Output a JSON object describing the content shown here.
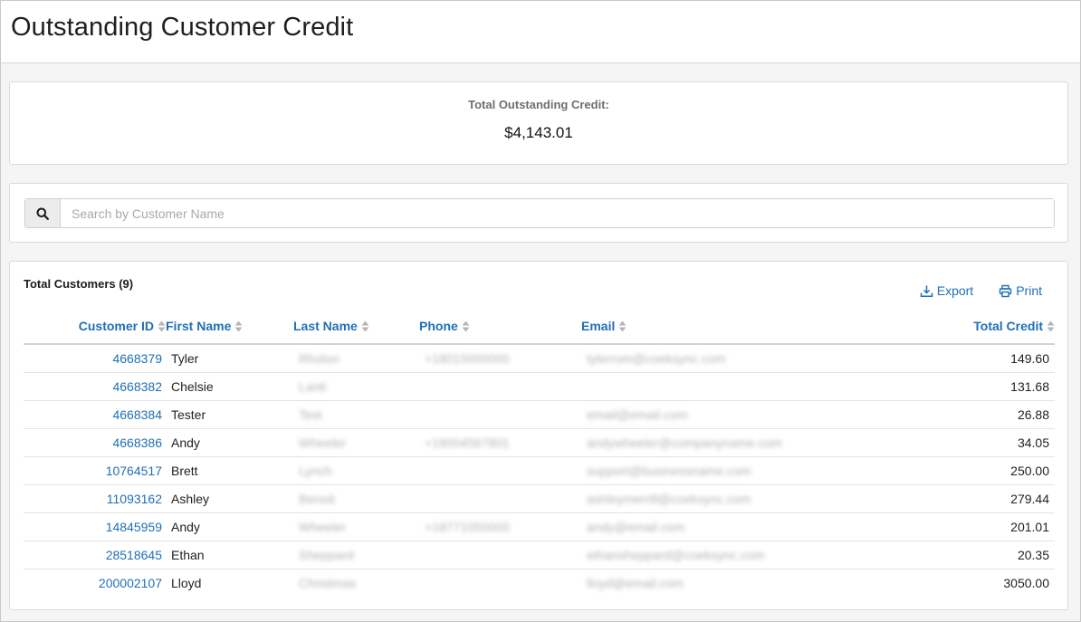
{
  "page": {
    "title": "Outstanding Customer Credit"
  },
  "summary": {
    "label": "Total Outstanding Credit:",
    "value": "$4,143.01"
  },
  "search": {
    "placeholder": "Search by Customer Name"
  },
  "table": {
    "total_label": "Total Customers (9)",
    "export_label": "Export",
    "print_label": "Print",
    "columns": {
      "customer_id": "Customer ID",
      "first_name": "First Name",
      "last_name": "Last Name",
      "phone": "Phone",
      "email": "Email",
      "total_credit": "Total Credit"
    },
    "rows": [
      {
        "id": "4668379",
        "first": "Tyler",
        "last": "Rhoton",
        "phone": "+18015000000",
        "email": "tylerrom@coeksync.com",
        "credit": "149.60"
      },
      {
        "id": "4668382",
        "first": "Chelsie",
        "last": "Lanti",
        "phone": "",
        "email": "",
        "credit": "131.68"
      },
      {
        "id": "4668384",
        "first": "Tester",
        "last": "Test",
        "phone": "",
        "email": "email@email.com",
        "credit": "26.88"
      },
      {
        "id": "4668386",
        "first": "Andy",
        "last": "Wheeler",
        "phone": "+18004567801",
        "email": "andywheeler@companyname.com",
        "credit": "34.05"
      },
      {
        "id": "10764517",
        "first": "Brett",
        "last": "Lynch",
        "phone": "",
        "email": "support@businessname.com",
        "credit": "250.00"
      },
      {
        "id": "11093162",
        "first": "Ashley",
        "last": "Benoit",
        "phone": "",
        "email": "ashleymerrill@coeksync.com",
        "credit": "279.44"
      },
      {
        "id": "14845959",
        "first": "Andy",
        "last": "Wheeler",
        "phone": "+18771050000",
        "email": "andy@email.com",
        "credit": "201.01"
      },
      {
        "id": "28518645",
        "first": "Ethan",
        "last": "Sheppard",
        "phone": "",
        "email": "ethansheppard@coeksync.com",
        "credit": "20.35"
      },
      {
        "id": "200002107",
        "first": "Lloyd",
        "last": "Christmas",
        "phone": "",
        "email": "lloyd@email.com",
        "credit": "3050.00"
      }
    ]
  },
  "colors": {
    "accent": "#1f6fb6",
    "header_text": "#1f1f1f",
    "label_grey": "#6e6e6e"
  },
  "icons": {
    "search": "search-icon",
    "export": "download-icon",
    "print": "printer-icon",
    "sort": "sort-icon"
  }
}
